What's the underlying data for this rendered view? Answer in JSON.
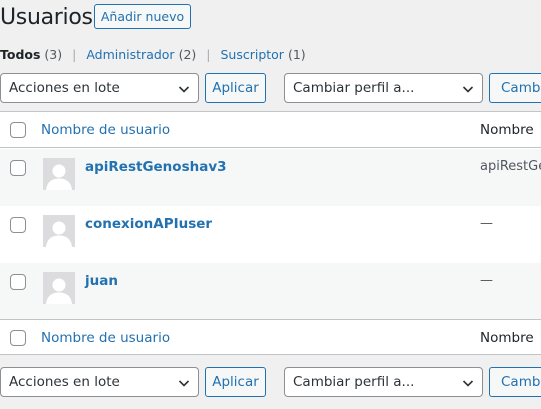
{
  "page": {
    "title": "Usuarios",
    "add_new_label": "Añadir nuevo"
  },
  "filters": {
    "all_label": "Todos",
    "all_count": "(3)",
    "admin_label": "Administrador",
    "admin_count": "(2)",
    "subscriber_label": "Suscriptor",
    "subscriber_count": "(1)",
    "separator": "|"
  },
  "tablenav_top": {
    "bulk_actions_selected": "Acciones en lote",
    "apply_label": "Aplicar",
    "change_role_selected": "Cambiar perfil a...",
    "change_button_label": "Cambia"
  },
  "tablenav_bottom": {
    "bulk_actions_selected": "Acciones en lote",
    "apply_label": "Aplicar",
    "change_role_selected": "Cambiar perfil a...",
    "change_button_label": "Cambia"
  },
  "table": {
    "columns": {
      "username": "Nombre de usuario",
      "name": "Nombre"
    },
    "rows": [
      {
        "username": "apiRestGenoshav3",
        "name": "apiRestGen"
      },
      {
        "username": "conexionAPIuser",
        "name": "—"
      },
      {
        "username": "juan",
        "name": "—"
      }
    ]
  },
  "icons": {
    "avatar": "default-user-avatar-icon",
    "dropdown": "chevron-down-icon"
  },
  "colors": {
    "link": "#2271b1",
    "background": "#f0f0f1",
    "border": "#c3c4c7",
    "stripe": "#f6f7f7"
  }
}
